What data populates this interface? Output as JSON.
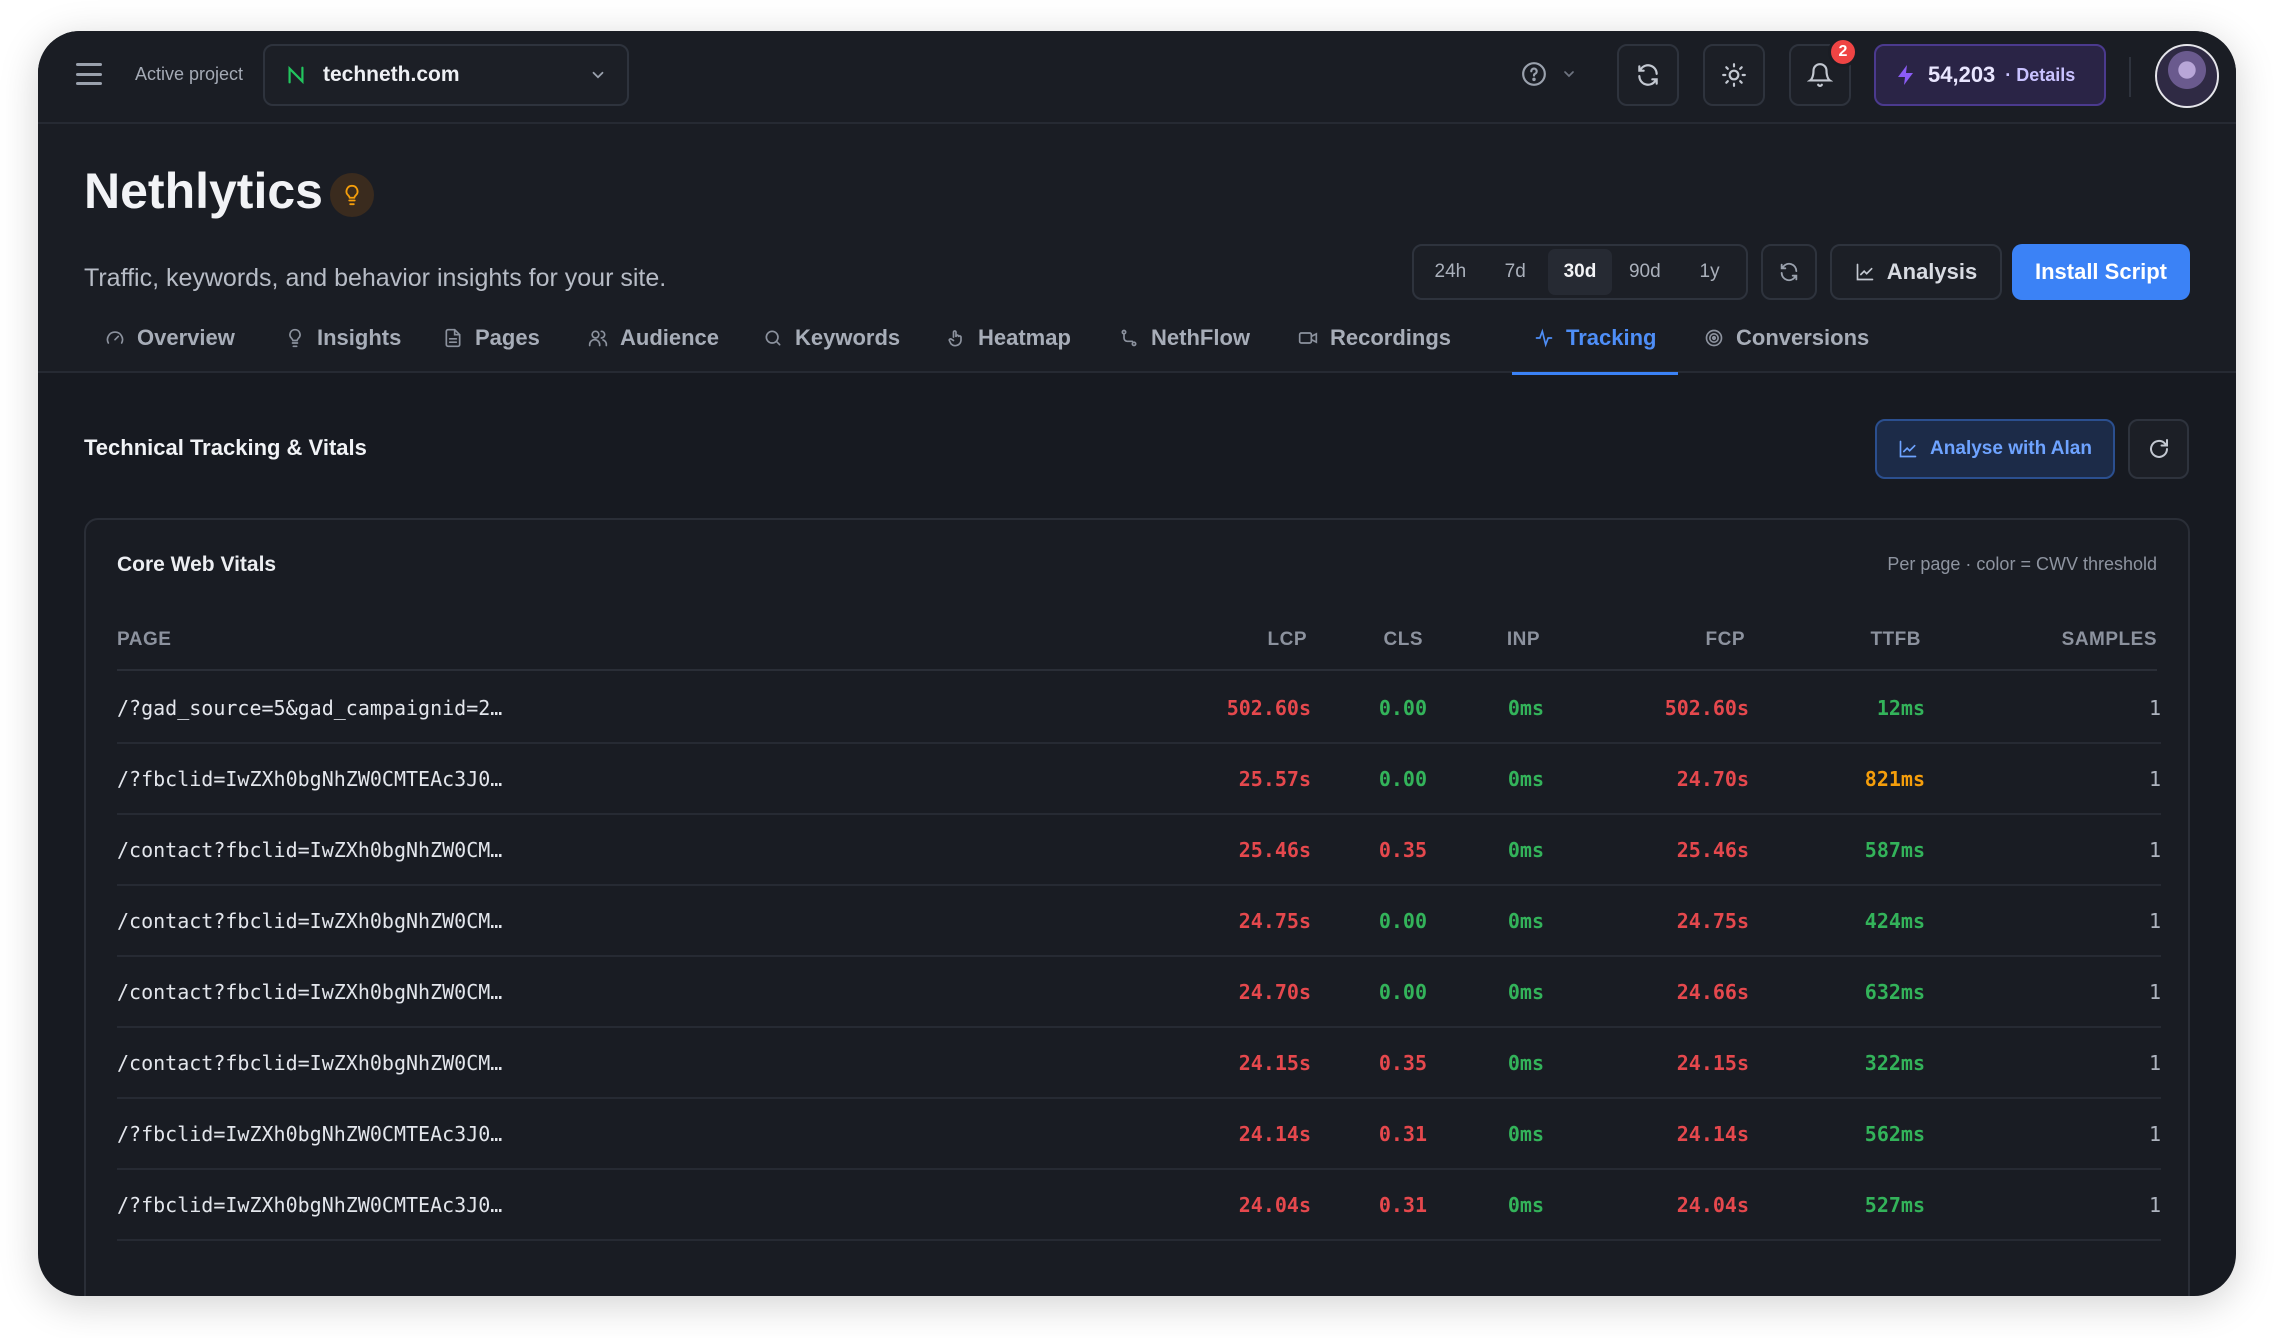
{
  "topbar": {
    "active_label": "Active project",
    "project_name": "techneth.com",
    "notifications_count": "2",
    "credits_value": "54,203",
    "credits_details": "· Details"
  },
  "header": {
    "title": "Nethlytics",
    "subtitle": "Traffic, keywords, and behavior insights for your site.",
    "ranges": [
      "24h",
      "7d",
      "30d",
      "90d",
      "1y"
    ],
    "active_range": "30d",
    "analysis_label": "Analysis",
    "install_label": "Install Script"
  },
  "tabs": [
    {
      "label": "Overview",
      "icon": "gauge-icon"
    },
    {
      "label": "Insights",
      "icon": "lightbulb-icon"
    },
    {
      "label": "Pages",
      "icon": "file-icon"
    },
    {
      "label": "Audience",
      "icon": "users-icon"
    },
    {
      "label": "Keywords",
      "icon": "search-icon"
    },
    {
      "label": "Heatmap",
      "icon": "pointer-icon"
    },
    {
      "label": "NethFlow",
      "icon": "flow-icon"
    },
    {
      "label": "Recordings",
      "icon": "video-icon"
    },
    {
      "label": "Tracking",
      "icon": "activity-icon"
    },
    {
      "label": "Conversions",
      "icon": "target-icon"
    }
  ],
  "active_tab": "Tracking",
  "section": {
    "title": "Technical Tracking & Vitals",
    "analyse_label": "Analyse with Alan"
  },
  "card": {
    "title": "Core Web Vitals",
    "note": "Per page · color = CWV threshold",
    "columns": [
      "PAGE",
      "LCP",
      "CLS",
      "INP",
      "FCP",
      "TTFB",
      "SAMPLES"
    ],
    "rows": [
      {
        "page": "/?gad_source=5&gad_campaignid=2…",
        "lcp": "502.60s",
        "cls": "0.00",
        "inp": "0ms",
        "fcp": "502.60s",
        "ttfb": "12ms",
        "samples": "1",
        "status": [
          "bad",
          "good",
          "good",
          "bad",
          "good"
        ]
      },
      {
        "page": "/?fbclid=IwZXh0bgNhZW0CMTEAc3J0…",
        "lcp": "25.57s",
        "cls": "0.00",
        "inp": "0ms",
        "fcp": "24.70s",
        "ttfb": "821ms",
        "samples": "1",
        "status": [
          "bad",
          "good",
          "good",
          "bad",
          "warn"
        ]
      },
      {
        "page": "/contact?fbclid=IwZXh0bgNhZW0CM…",
        "lcp": "25.46s",
        "cls": "0.35",
        "inp": "0ms",
        "fcp": "25.46s",
        "ttfb": "587ms",
        "samples": "1",
        "status": [
          "bad",
          "bad",
          "good",
          "bad",
          "good"
        ]
      },
      {
        "page": "/contact?fbclid=IwZXh0bgNhZW0CM…",
        "lcp": "24.75s",
        "cls": "0.00",
        "inp": "0ms",
        "fcp": "24.75s",
        "ttfb": "424ms",
        "samples": "1",
        "status": [
          "bad",
          "good",
          "good",
          "bad",
          "good"
        ]
      },
      {
        "page": "/contact?fbclid=IwZXh0bgNhZW0CM…",
        "lcp": "24.70s",
        "cls": "0.00",
        "inp": "0ms",
        "fcp": "24.66s",
        "ttfb": "632ms",
        "samples": "1",
        "status": [
          "bad",
          "good",
          "good",
          "bad",
          "good"
        ]
      },
      {
        "page": "/contact?fbclid=IwZXh0bgNhZW0CM…",
        "lcp": "24.15s",
        "cls": "0.35",
        "inp": "0ms",
        "fcp": "24.15s",
        "ttfb": "322ms",
        "samples": "1",
        "status": [
          "bad",
          "bad",
          "good",
          "bad",
          "good"
        ]
      },
      {
        "page": "/?fbclid=IwZXh0bgNhZW0CMTEAc3J0…",
        "lcp": "24.14s",
        "cls": "0.31",
        "inp": "0ms",
        "fcp": "24.14s",
        "ttfb": "562ms",
        "samples": "1",
        "status": [
          "bad",
          "bad",
          "good",
          "bad",
          "good"
        ]
      },
      {
        "page": "/?fbclid=IwZXh0bgNhZW0CMTEAc3J0…",
        "lcp": "24.04s",
        "cls": "0.31",
        "inp": "0ms",
        "fcp": "24.04s",
        "ttfb": "527ms",
        "samples": "1",
        "status": [
          "bad",
          "bad",
          "good",
          "bad",
          "good"
        ]
      }
    ]
  },
  "colors": {
    "accent": "#3b82f6",
    "bad": "#e5484d",
    "good": "#33b35a",
    "warn": "#f59e0b",
    "credits": "#8b5cf6"
  }
}
